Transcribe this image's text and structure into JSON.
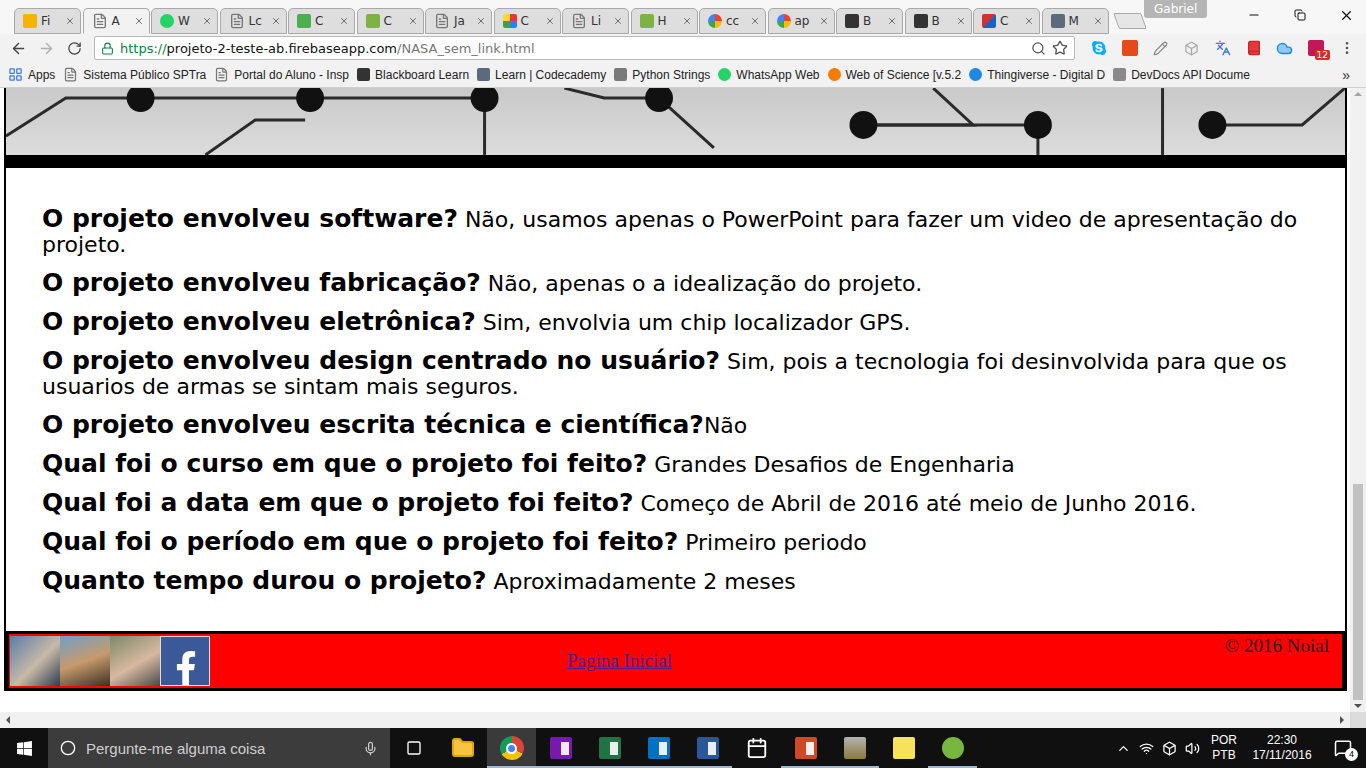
{
  "browser": {
    "tabs": [
      {
        "label": "Fi",
        "kind": "slides",
        "selected": false
      },
      {
        "label": "A",
        "kind": "page",
        "selected": true
      },
      {
        "label": "W",
        "kind": "whatsapp",
        "selected": false
      },
      {
        "label": "Lc",
        "kind": "page",
        "selected": false
      },
      {
        "label": "C",
        "kind": "w3",
        "selected": false
      },
      {
        "label": "C",
        "kind": "green",
        "selected": false
      },
      {
        "label": "Ja",
        "kind": "page",
        "selected": false
      },
      {
        "label": "C",
        "kind": "chart",
        "selected": false
      },
      {
        "label": "Li",
        "kind": "page",
        "selected": false
      },
      {
        "label": "H",
        "kind": "green",
        "selected": false
      },
      {
        "label": "cc",
        "kind": "google",
        "selected": false
      },
      {
        "label": "ap",
        "kind": "google",
        "selected": false
      },
      {
        "label": "B",
        "kind": "bb",
        "selected": false
      },
      {
        "label": "B",
        "kind": "bb",
        "selected": false
      },
      {
        "label": "C",
        "kind": "c",
        "selected": false
      },
      {
        "label": "M",
        "kind": "codecademy",
        "selected": false
      }
    ],
    "profile": "Gabriel",
    "address": {
      "scheme": "https://",
      "host": "projeto-2-teste-ab.firebaseapp.com",
      "path": "/NASA_sem_link.html",
      "secure": true,
      "starred": false
    },
    "extension_badge": "12",
    "bookmarks": [
      {
        "label": "Apps",
        "kind": "apps"
      },
      {
        "label": "Sistema Público SPTra",
        "kind": "page"
      },
      {
        "label": "Portal do Aluno - Insp",
        "kind": "page"
      },
      {
        "label": "Blackboard Learn",
        "kind": "bb"
      },
      {
        "label": "Learn | Codecademy",
        "kind": "codecademy"
      },
      {
        "label": "Python Strings",
        "kind": "python"
      },
      {
        "label": "WhatsApp Web",
        "kind": "whatsapp"
      },
      {
        "label": "Web of Science [v.5.2",
        "kind": "wos"
      },
      {
        "label": "Thingiverse - Digital D",
        "kind": "thingiverse"
      },
      {
        "label": "DevDocs API Docume",
        "kind": "devdocs"
      }
    ],
    "bookmarks_more": "»"
  },
  "page": {
    "items": [
      {
        "question": "O projeto envolveu software?",
        "answer": " Não, usamos apenas o PowerPoint para fazer um video de apresentação do projeto."
      },
      {
        "question": "O projeto envolveu fabricação?",
        "answer": " Não, apenas o a idealização do projeto."
      },
      {
        "question": "O projeto envolveu eletrônica?",
        "answer": " Sim, envolvia um chip localizador GPS."
      },
      {
        "question": "O projeto envolveu design centrado no usuário?",
        "answer": " Sim, pois a tecnologia foi desinvolvida para que os usuarios de armas se sintam mais seguros."
      },
      {
        "question": "O projeto envolveu escrita técnica e científica?",
        "answer": "Não"
      },
      {
        "question": "Qual foi o curso em que o projeto foi feito?",
        "answer": " Grandes Desafios de Engenharia"
      },
      {
        "question": "Qual foi a data em que o projeto foi feito?",
        "answer": " Começo de Abril de 2016 até meio de Junho 2016."
      },
      {
        "question": "Qual foi o período em que o projeto foi feito?",
        "answer": " Primeiro periodo"
      },
      {
        "question": "Quanto tempo durou o projeto?",
        "answer": " Aproximadamente 2 meses"
      }
    ],
    "footer": {
      "link": "Pagina Inicial",
      "copyright": "© 2016 Noial",
      "photos": 3
    },
    "scroll": {
      "vertical": {
        "level": 1,
        "thumb": 0.36
      },
      "horizontal": {
        "level": 0,
        "thumb": 0.99
      }
    }
  },
  "taskbar": {
    "search_placeholder": "Pergunte-me alguma coisa",
    "apps": [
      {
        "kind": "folder",
        "running": false,
        "selected": false
      },
      {
        "kind": "chrome",
        "running": true,
        "selected": true
      },
      {
        "kind": "onenote",
        "running": true,
        "selected": false
      },
      {
        "kind": "excel",
        "running": true,
        "selected": false
      },
      {
        "kind": "outlook",
        "running": true,
        "selected": false
      },
      {
        "kind": "word",
        "running": true,
        "selected": false
      },
      {
        "kind": "calendar",
        "running": false,
        "selected": false
      },
      {
        "kind": "powerpoint",
        "running": true,
        "selected": false
      },
      {
        "kind": "app",
        "running": true,
        "selected": false
      },
      {
        "kind": "sticky",
        "running": false,
        "selected": false
      },
      {
        "kind": "utorrent",
        "running": true,
        "selected": false
      }
    ],
    "language": [
      "POR",
      "PTB"
    ],
    "time": "22:30",
    "date": "17/11/2016",
    "notifications": "4"
  }
}
